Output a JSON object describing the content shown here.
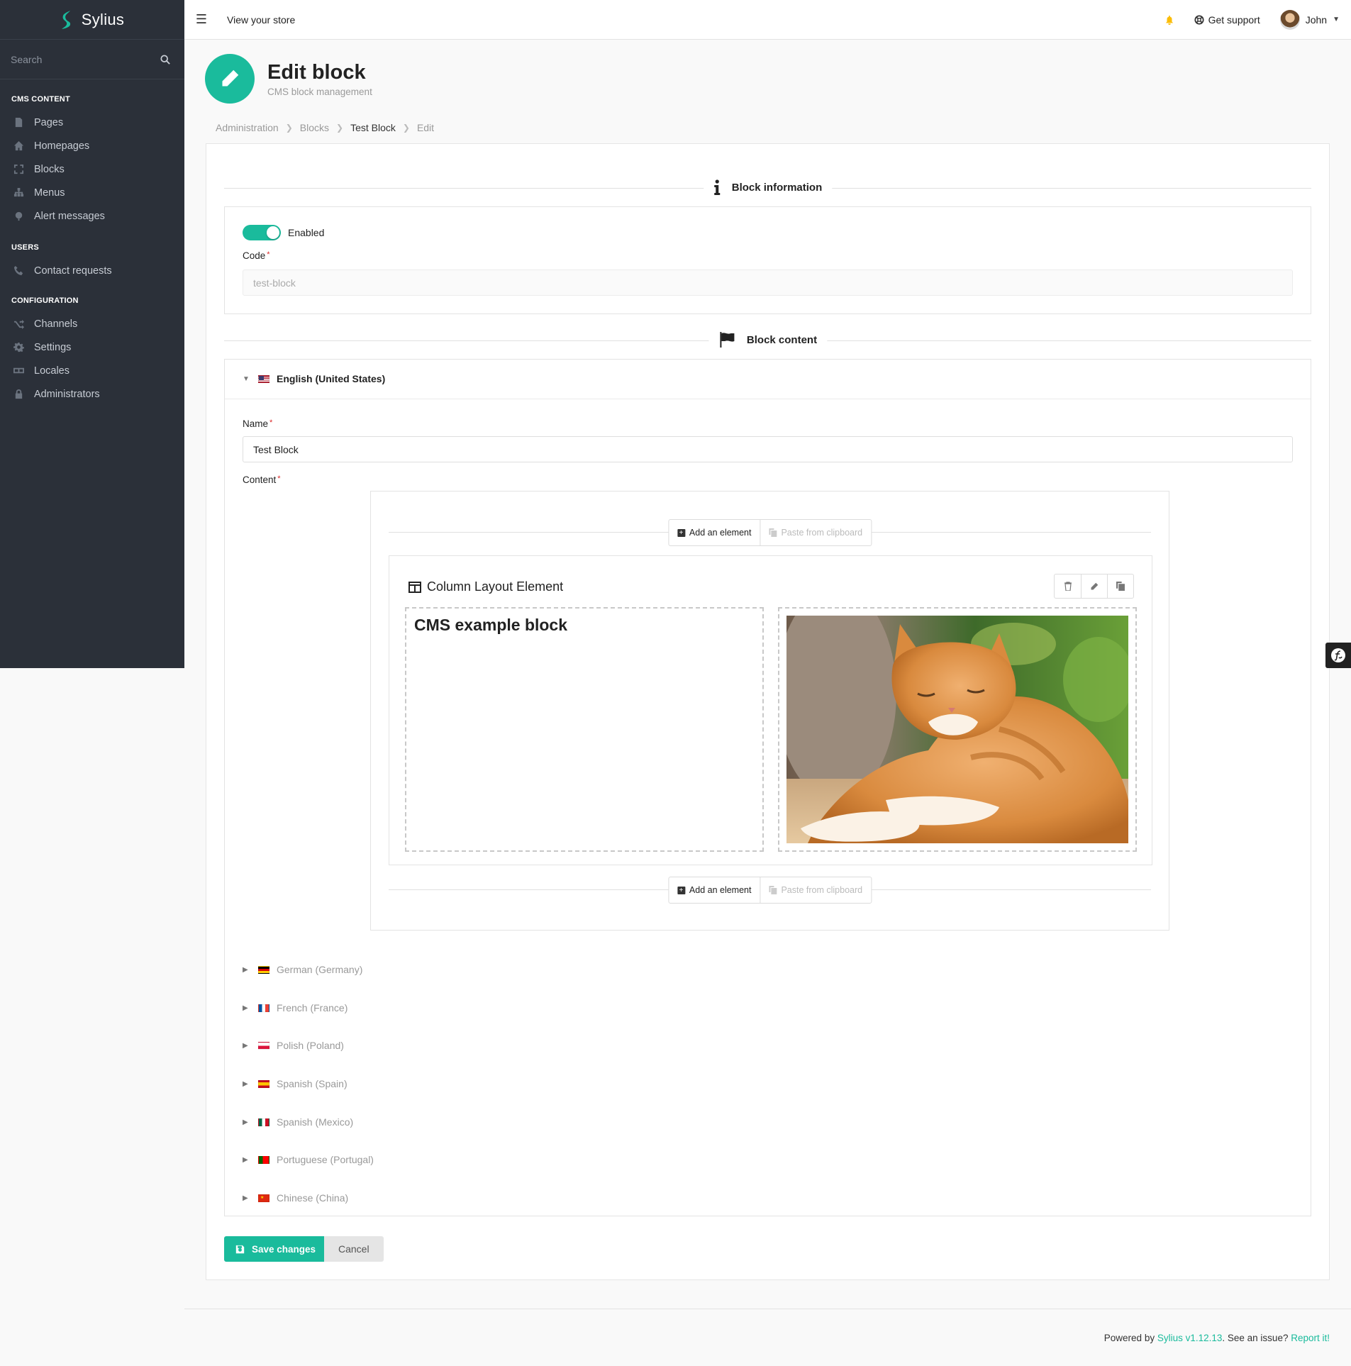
{
  "brand": {
    "name": "Sylius",
    "logo_icon": "sylius-logo-icon",
    "color": "#1abb9c"
  },
  "sidebar": {
    "search_placeholder": "Search",
    "sections": [
      {
        "title": "CMS CONTENT",
        "items": [
          {
            "label": "Pages",
            "icon": "file-icon"
          },
          {
            "label": "Homepages",
            "icon": "home-icon"
          },
          {
            "label": "Blocks",
            "icon": "expand-icon"
          },
          {
            "label": "Menus",
            "icon": "sitemap-icon"
          },
          {
            "label": "Alert messages",
            "icon": "bullhorn-icon"
          }
        ]
      },
      {
        "title": "USERS",
        "items": [
          {
            "label": "Contact requests",
            "icon": "phone-icon"
          }
        ]
      },
      {
        "title": "CONFIGURATION",
        "items": [
          {
            "label": "Channels",
            "icon": "shuffle-icon"
          },
          {
            "label": "Settings",
            "icon": "cog-icon"
          },
          {
            "label": "Locales",
            "icon": "translate-icon"
          },
          {
            "label": "Administrators",
            "icon": "lock-icon"
          }
        ]
      }
    ]
  },
  "topbar": {
    "view_store": "View your store",
    "support": "Get support",
    "user": "John",
    "bell_color": "#fbbd08"
  },
  "header": {
    "title": "Edit block",
    "subtitle": "CMS block management"
  },
  "breadcrumb": [
    "Administration",
    "Blocks",
    "Test Block",
    "Edit"
  ],
  "block_information": {
    "title": "Block information",
    "enabled_label": "Enabled",
    "code_label": "Code",
    "code_value": "test-block"
  },
  "block_content": {
    "title": "Block content",
    "open_locale": "English (United States)",
    "name_label": "Name",
    "name_value": "Test Block",
    "content_label": "Content",
    "add_element": "Add an element",
    "paste_clipboard": "Paste from clipboard",
    "element_title": "Column Layout Element",
    "column_heading": "CMS example block",
    "locales": [
      "German (Germany)",
      "French (France)",
      "Polish (Poland)",
      "Spanish (Spain)",
      "Spanish (Mexico)",
      "Portuguese (Portugal)",
      "Chinese (China)"
    ]
  },
  "actions": {
    "save": "Save changes",
    "cancel": "Cancel"
  },
  "footer": {
    "prefix": "Powered by ",
    "version": "Sylius v1.12.13",
    "middle": ". See an issue? ",
    "report": "Report it!"
  }
}
